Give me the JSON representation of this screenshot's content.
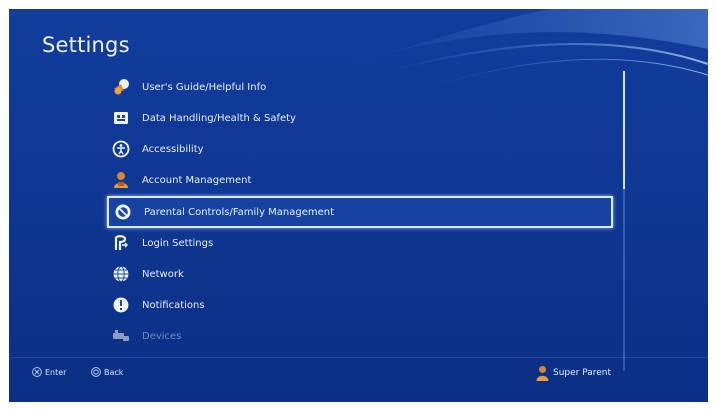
{
  "screen": {
    "title": "Settings",
    "colors": {
      "background_top": "#123d9c",
      "background_bottom": "#0b2f84",
      "text": "#e9efff",
      "selection_border": "#dfe9ff"
    }
  },
  "menu": {
    "items": [
      {
        "label": "User's Guide/Helpful Info",
        "icon": "help-icon"
      },
      {
        "label": "Data Handling/Health & Safety",
        "icon": "shield-icon"
      },
      {
        "label": "Accessibility",
        "icon": "accessibility-icon"
      },
      {
        "label": "Account Management",
        "icon": "account-icon"
      },
      {
        "label": "Parental Controls/Family Management",
        "icon": "parental-controls-icon",
        "selected": true
      },
      {
        "label": "Login Settings",
        "icon": "login-icon"
      },
      {
        "label": "Network",
        "icon": "globe-icon"
      },
      {
        "label": "Notifications",
        "icon": "notification-icon"
      },
      {
        "label": "Devices",
        "icon": "controller-icon",
        "faded": true
      }
    ]
  },
  "footer": {
    "enter_label": "Enter",
    "back_label": "Back",
    "user_name": "Super Parent"
  }
}
